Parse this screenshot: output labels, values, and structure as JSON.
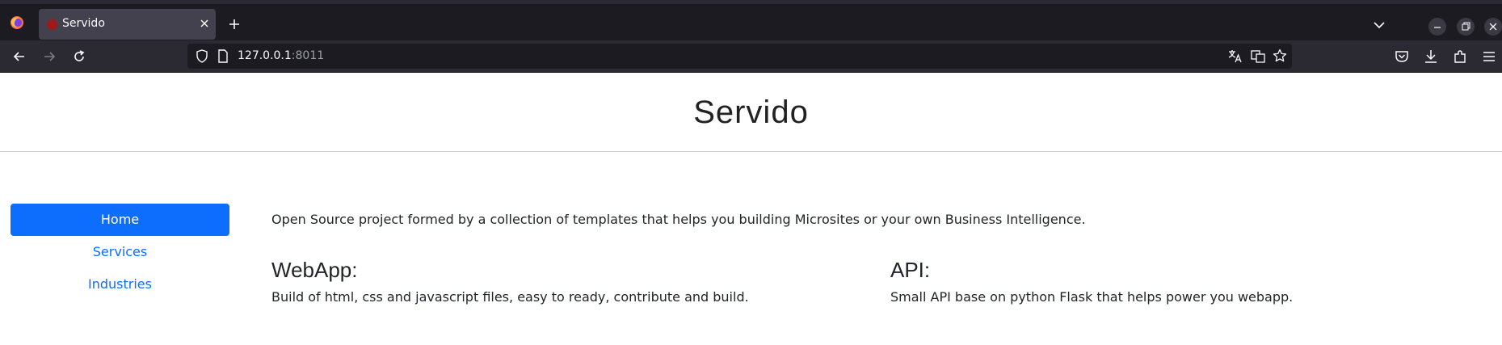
{
  "browser": {
    "tab_title": "Servido",
    "url_host": "127.0.0.1",
    "url_port": ":8011"
  },
  "site": {
    "title": "Servido"
  },
  "sidebar": {
    "items": [
      {
        "label": "Home",
        "active": true
      },
      {
        "label": "Services",
        "active": false
      },
      {
        "label": "Industries",
        "active": false
      }
    ]
  },
  "main": {
    "intro": "Open Source project formed by a collection of templates that helps you building Microsites or your own Business Intelligence.",
    "sections": [
      {
        "heading": "WebApp:",
        "text": "Build of html, css and javascript files, easy to ready, contribute and build."
      },
      {
        "heading": "API:",
        "text": "Small API base on python Flask that helps power you webapp."
      }
    ]
  },
  "colors": {
    "accent": "#0d6efd",
    "chrome_dark": "#1c1b22",
    "chrome_mid": "#2b2a33"
  }
}
